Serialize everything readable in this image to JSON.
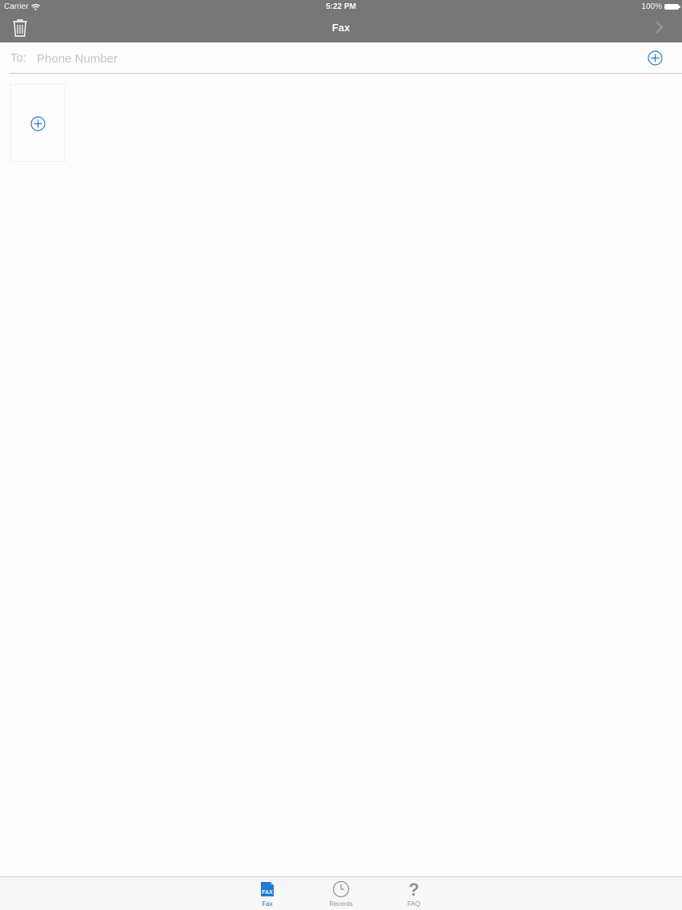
{
  "status_bar": {
    "carrier": "Carrier",
    "time": "5:22 PM",
    "battery": "100%"
  },
  "nav": {
    "title": "Fax",
    "left_icon": "trash-icon",
    "right_icon": "chevron-right-icon"
  },
  "recipient": {
    "label": "To:",
    "placeholder": "Phone Number",
    "value": "",
    "add_icon": "plus-circle-icon"
  },
  "pages": {
    "add_icon": "plus-circle-icon"
  },
  "tab_bar": {
    "tabs": [
      {
        "label": "Fax",
        "icon": "fax-icon",
        "active": true
      },
      {
        "label": "Recents",
        "icon": "clock-icon",
        "active": false
      },
      {
        "label": "FAQ",
        "icon": "question-mark-icon",
        "active": false
      }
    ]
  },
  "colors": {
    "nav_background": "#777777",
    "accent": "#1e7ad6",
    "tab_inactive": "#929292"
  }
}
